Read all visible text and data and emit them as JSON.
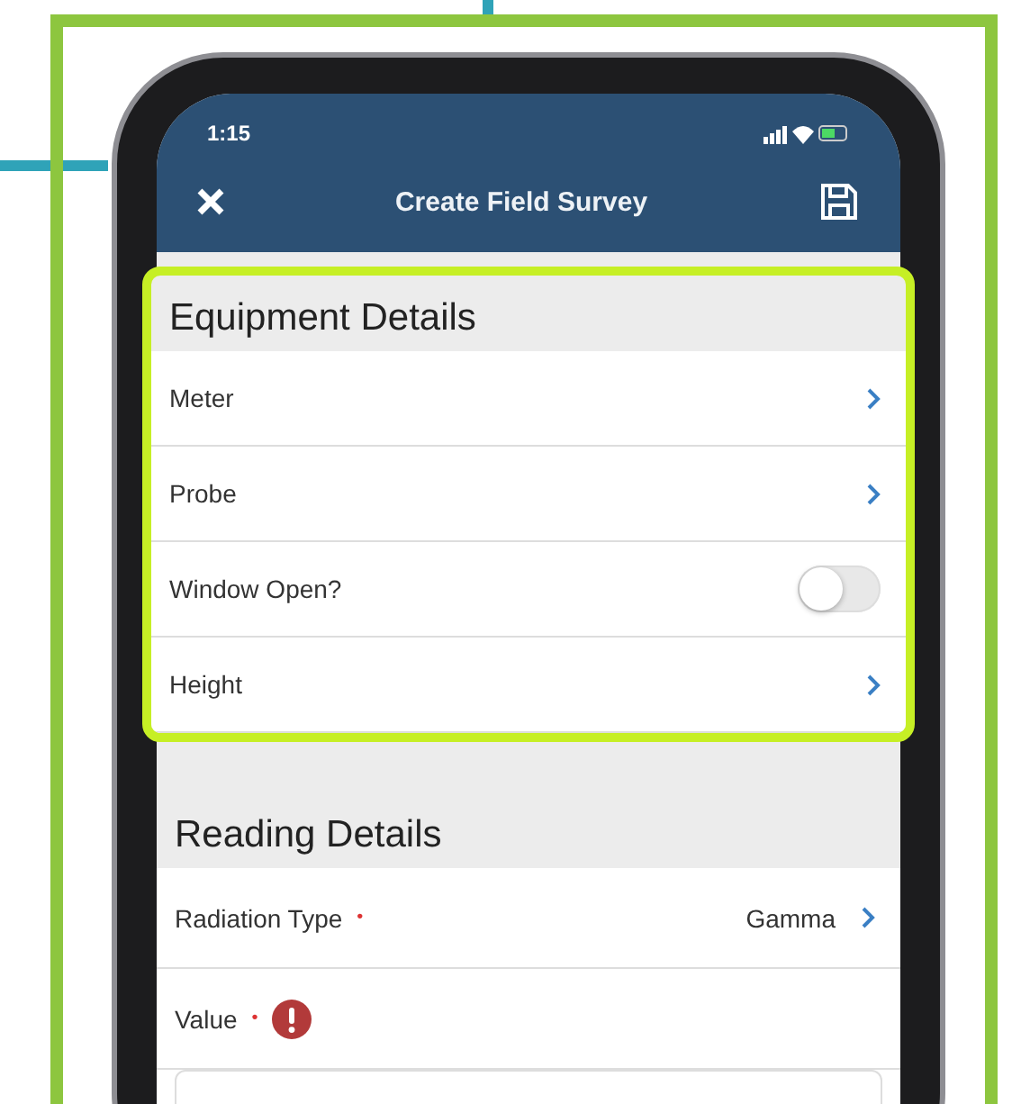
{
  "status_bar": {
    "time": "1:15"
  },
  "nav_bar": {
    "title": "Create Field Survey"
  },
  "sections": [
    {
      "title": "Equipment Details",
      "highlighted": true,
      "fields": [
        {
          "kind": "link",
          "label": "Meter",
          "error": false
        },
        {
          "kind": "link",
          "label": "Probe",
          "error": false
        },
        {
          "kind": "toggle",
          "label": "Window Open?",
          "error": false,
          "on": false
        },
        {
          "kind": "link",
          "label": "Height",
          "error": false
        }
      ]
    },
    {
      "title": "Reading Details",
      "highlighted": false,
      "fields": [
        {
          "kind": "link",
          "label": "Radiation Type",
          "required_mark": "•",
          "error": false,
          "value": "Gamma"
        },
        {
          "kind": "input",
          "label": "Value",
          "required_mark": "•",
          "error": true
        }
      ]
    }
  ]
}
